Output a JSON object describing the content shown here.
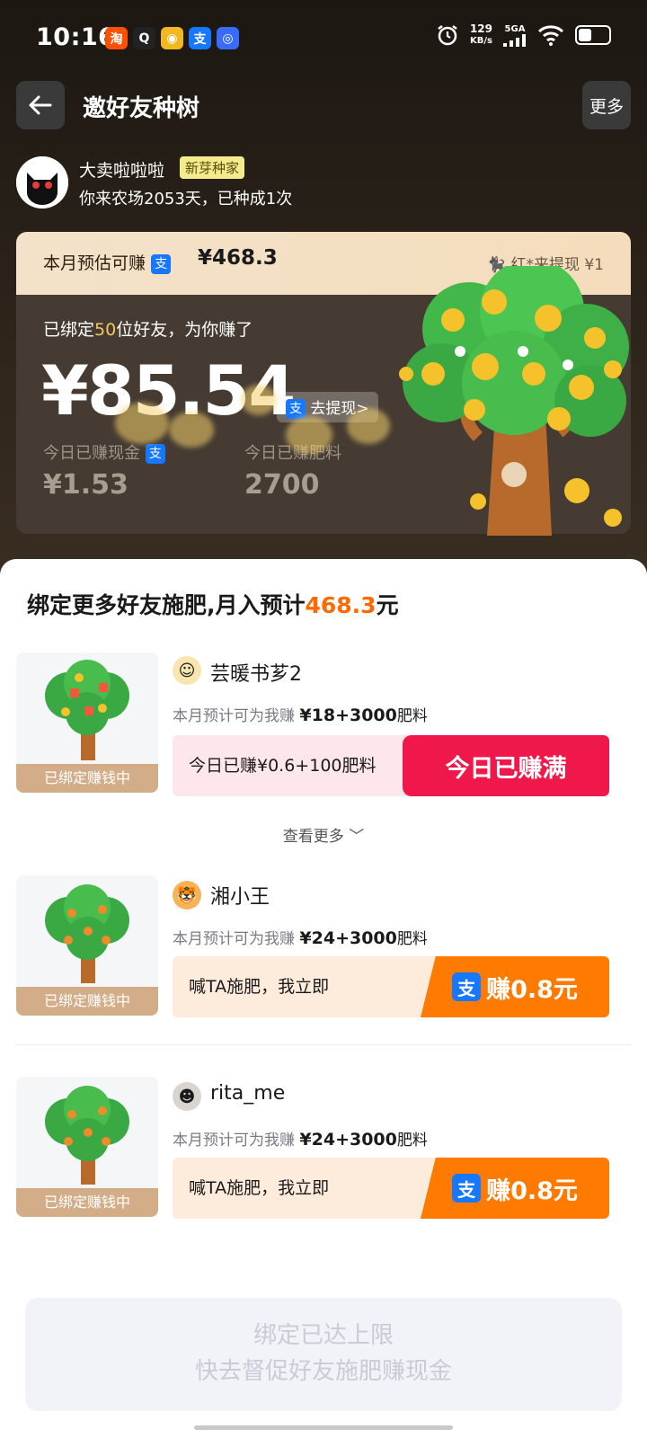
{
  "status_bar": {
    "time": "10:16",
    "apps": [
      {
        "name": "taobao-icon",
        "glyph": "淘",
        "color": "#ff5000"
      },
      {
        "name": "qq-icon",
        "glyph": "Q",
        "color": "#222222"
      },
      {
        "name": "app-icon",
        "glyph": "◉",
        "color": "#f3b81f"
      },
      {
        "name": "alipay-icon",
        "glyph": "支",
        "color": "#1677ff"
      },
      {
        "name": "chat-icon",
        "glyph": "◎",
        "color": "#3a6bff"
      }
    ],
    "net_speed_value": "129",
    "net_speed_unit": "KB/s",
    "signal": "5GA"
  },
  "header": {
    "title": "邀好友种树",
    "more_label": "更多"
  },
  "user": {
    "name": "大卖啦啦啦",
    "badge": "新芽种家",
    "subtitle": "你来农场2053天，已种成1次"
  },
  "earn_card": {
    "top_label": "本月预估可赚",
    "top_amount": "¥468.3",
    "top_right": "红*来提现 ¥1",
    "bound_prefix": "已绑定",
    "bound_count": "50",
    "bound_suffix": "位好友，为你赚了",
    "total": "¥85.54",
    "withdraw_label": "去提现>",
    "today_cash_label": "今日已赚现金",
    "today_cash_value": "¥1.53",
    "today_fert_label": "今日已赚肥料",
    "today_fert_value": "2700"
  },
  "sheet": {
    "title_prefix": "绑定更多好友施肥,月入预计",
    "title_amount": "468.3",
    "title_suffix": "元",
    "thumb_label": "已绑定赚钱中",
    "est_prefix": "本月预计可为我赚",
    "see_more": "查看更多"
  },
  "friends": [
    {
      "name": "芸暖书芗2",
      "avatar_glyph": "☺",
      "avatar_color": "#f7e6b0",
      "est": "¥18+3000",
      "est_unit": "肥料",
      "action_text": "今日已赚¥0.6+100肥料",
      "button": "今日已赚满"
    },
    {
      "name": "湘小王",
      "avatar_glyph": "🐯",
      "avatar_color": "#f6b45a",
      "est": "¥24+3000",
      "est_unit": "肥料",
      "action_text": "喊TA施肥，我立即",
      "button": "赚0.8元"
    },
    {
      "name": "rita_me",
      "avatar_glyph": "☻",
      "avatar_color": "#d8d4cf",
      "est": "¥24+3000",
      "est_unit": "肥料",
      "action_text": "喊TA施肥，我立即",
      "button": "赚0.8元"
    }
  ],
  "limit": {
    "line1": "绑定已达上限",
    "line2": "快去督促好友施肥赚现金"
  }
}
